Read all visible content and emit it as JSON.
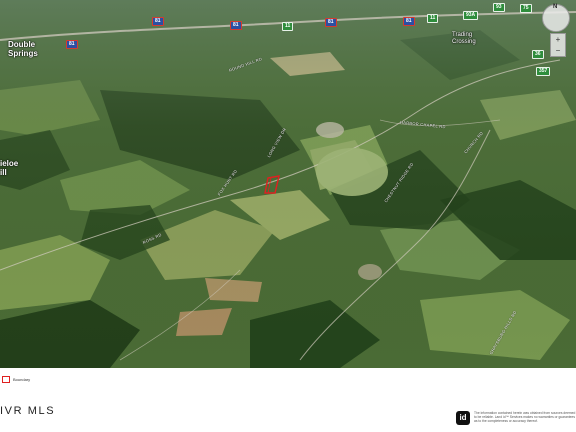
{
  "places": {
    "double_springs": "Double\nSprings",
    "hemlock_tail": "ieloe\nill",
    "trading_crossing": "Trading\nCrossing"
  },
  "shields": {
    "i81_a": "81",
    "i81_b": "81",
    "i81_c": "81",
    "i81_d": "81",
    "i81_e": "81",
    "us11_a": "11",
    "us11_b": "11",
    "sr93": "93",
    "sr93a": "93A",
    "sr75": "75",
    "sr36": "36",
    "sr357": "357"
  },
  "roads": {
    "r1": "ROUND HILL RD",
    "r2": "FOX HUNT RD",
    "r3": "HARBOR CHAPEL RD",
    "r4": "LONG VIEW DR",
    "r5": "CHESTNUT RIDGE RD",
    "r6": "ROSS RD",
    "r7": "CHURCH RD",
    "r8": "GRAYSBURG HILLS RD"
  },
  "controls": {
    "compass_n": "N",
    "zoom_in": "+",
    "zoom_out": "−"
  },
  "footer": {
    "legend_label": "Boundary",
    "brand": "IVR MLS",
    "logo": "id",
    "disclaimer": "The information contained herein was obtained from sources deemed to be reliable. Land id™ Services makes no warranties or guarantees as to the completeness or accuracy thereof."
  },
  "colors": {
    "boundary": "#e02020",
    "interstate": "#2c4fa3",
    "state_route": "#2f8d3c"
  }
}
